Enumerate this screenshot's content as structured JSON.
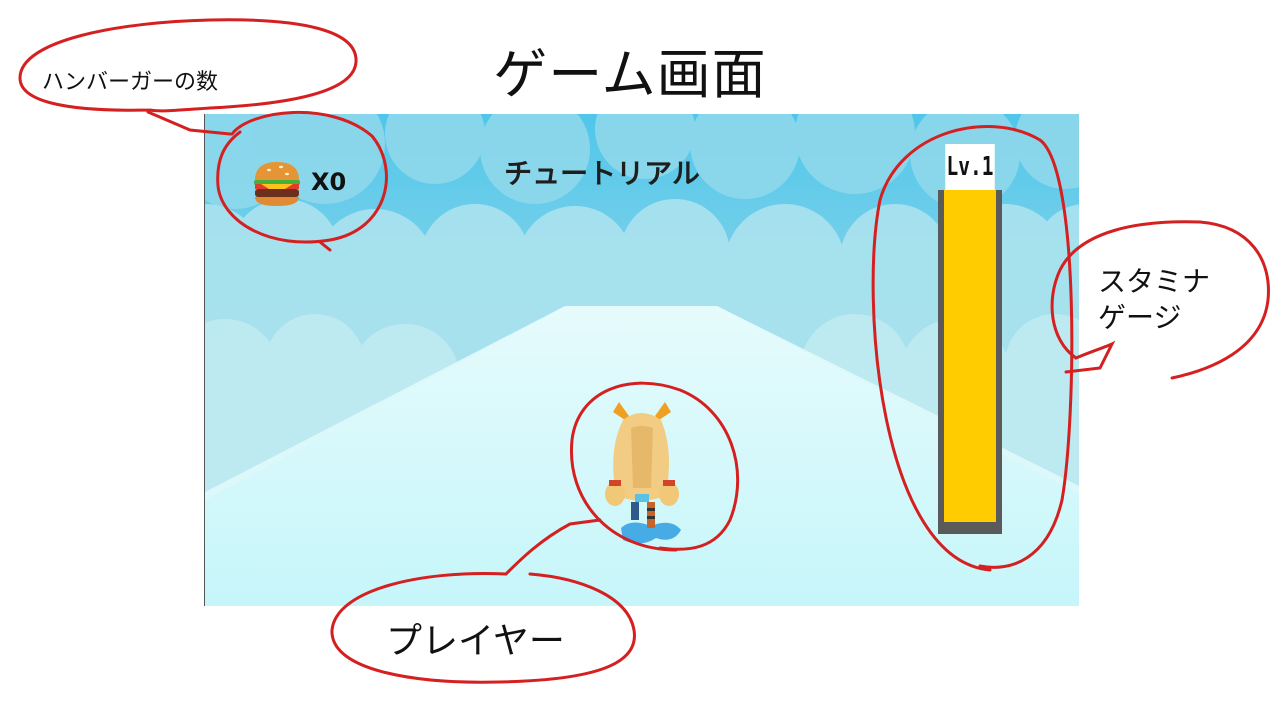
{
  "slide": {
    "title": "ゲーム画面"
  },
  "game": {
    "level_title": "チュートリアル",
    "burger_count_text": "X0",
    "stamina": {
      "level_label": "Lv.1",
      "fill_fraction": 1.0,
      "fill_color": "#ffcc00"
    }
  },
  "annotations": {
    "burger_label": "ハンバーガーの数",
    "stamina_label": "スタミナ\nゲージ",
    "player_label": "プレイヤー",
    "circle_color": "#d42020"
  },
  "icons": {
    "burger": "hamburger-icon",
    "player": "player-character"
  }
}
